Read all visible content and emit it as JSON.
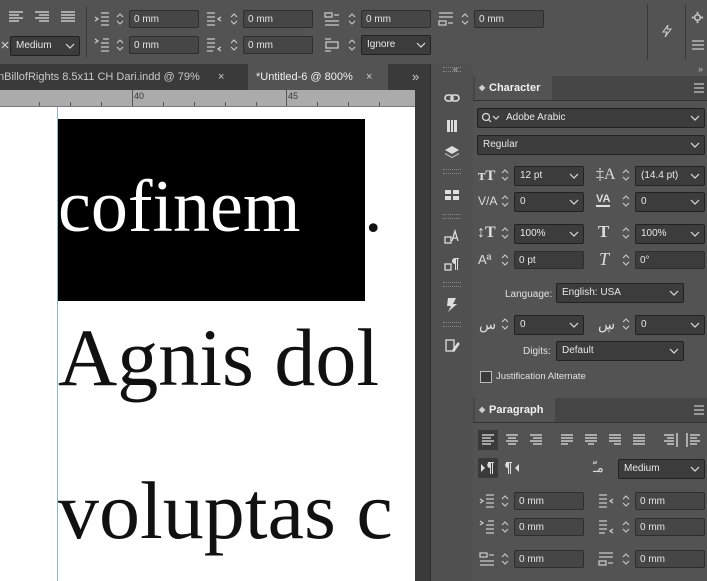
{
  "control_bar": {
    "fields": [
      "0 mm",
      "0 mm",
      "0 mm",
      "0 mm",
      "0 mm",
      "0 mm"
    ],
    "composer_value": "Medium",
    "ignore_value": "Ignore"
  },
  "tabs": [
    {
      "label": "nBillofRights 8.5x11 CH Dari.indd @ 79%",
      "close": "×"
    },
    {
      "label": "*Untitled-6 @ 800%",
      "close": "×"
    }
  ],
  "tab_overflow": "»",
  "ruler": {
    "labels": [
      "40",
      "45"
    ]
  },
  "document": {
    "lines": [
      "cofinem",
      ".",
      "Agnis dol",
      "voluptas c"
    ]
  },
  "character_panel": {
    "title": "Character",
    "font_family": "Adobe Arabic",
    "font_style": "Regular",
    "size": "12 pt",
    "leading": "(14.4 pt)",
    "kerning": "0",
    "tracking": "0",
    "vertical_scale": "100%",
    "horizontal_scale": "100%",
    "baseline_shift": "0 pt",
    "skew": "0°",
    "language_label": "Language:",
    "language": "English: USA",
    "arabic_field_1": "0",
    "arabic_field_2": "0",
    "digits_label": "Digits:",
    "digits": "Default",
    "justification_alternate": "Justification Alternate"
  },
  "paragraph_panel": {
    "title": "Paragraph",
    "composer": "Medium",
    "fields": [
      "0 mm",
      "0 mm",
      "0 mm",
      "0 mm",
      "0 mm",
      "0 mm"
    ]
  },
  "icons": [
    "align-left-icon",
    "align-center-icon",
    "align-right-icon",
    "left-indent-icon",
    "right-indent-icon",
    "space-before-icon",
    "space-after-icon",
    "lightning-icon",
    "gear-icon",
    "menu-icon",
    "links-icon",
    "stroke-icon",
    "layers-icon",
    "swatches-icon",
    "character-styles-icon",
    "paragraph-styles-icon",
    "pages-icon",
    "edit-icon"
  ],
  "colors": {
    "panel": "#535353",
    "dark": "#323232",
    "canvas": "#ffffff",
    "highlight": "#000000"
  }
}
